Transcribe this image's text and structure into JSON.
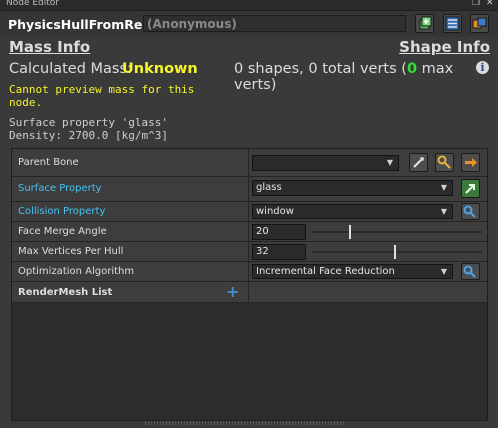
{
  "window": {
    "title": "Node Editor"
  },
  "header": {
    "node_name": "PhysicsHullFromRender",
    "name_field": "(Anonymous)"
  },
  "mass_info": {
    "title": "Mass Info",
    "calc_label": "Calculated Mass:",
    "calc_value": "Unknown",
    "warning_line1": "Cannot preview mass for this",
    "warning_line2": "node.",
    "surface_line1": "Surface property 'glass'",
    "surface_line2": "Density: 2700.0 [kg/m^3]"
  },
  "shape_info": {
    "title": "Shape Info",
    "stats_prefix": "0 shapes, 0 total verts (",
    "stats_green": "0",
    "stats_suffix": " max verts)",
    "info_glyph": "i"
  },
  "properties": {
    "parent_bone": {
      "label": "Parent Bone",
      "value": ""
    },
    "surface_property": {
      "label": "Surface Property",
      "value": "glass"
    },
    "collision_property": {
      "label": "Collision Property",
      "value": "window"
    },
    "face_merge_angle": {
      "label": "Face Merge Angle",
      "value": "20"
    },
    "max_vertices": {
      "label": "Max Vertices Per Hull",
      "value": "32"
    },
    "optimization": {
      "label": "Optimization Algorithm",
      "value": "Incremental Face Reduction"
    },
    "rendermesh_list": {
      "label": "RenderMesh List"
    }
  },
  "slider_levels": {
    "face_merge_angle": 0.22,
    "max_vertices": 0.48
  },
  "icons": {
    "titlebar": [
      "restore-icon",
      "close-icon"
    ],
    "header_buttons": [
      "add-node-icon",
      "list-icon",
      "link-icon"
    ],
    "parent_bone_buttons": [
      "pipette-icon",
      "search-key-icon",
      "arrow-right-icon"
    ],
    "surface_button": "open-icon",
    "collision_button": "search-icon",
    "optimization_button": "search-icon",
    "rendermesh_button": "plus-icon"
  },
  "colors": {
    "warning": "#f5f52a",
    "link": "#45c3f0",
    "green": "#35e035"
  }
}
